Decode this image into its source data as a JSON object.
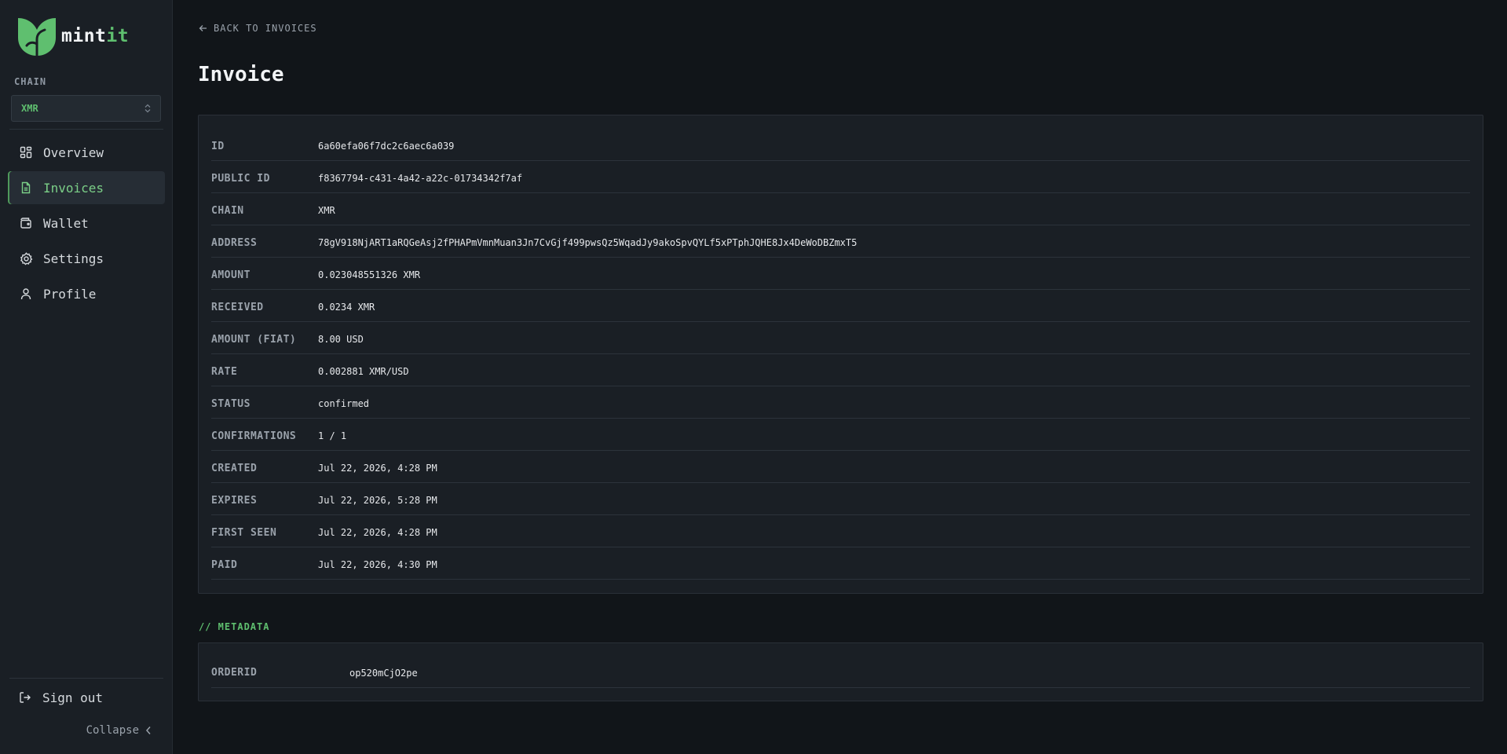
{
  "brand": {
    "name_main": "mint",
    "name_accent": "it",
    "accent_color": "#5fbf6f"
  },
  "sidebar": {
    "chain_label": "CHAIN",
    "chain_value": "XMR",
    "nav": [
      {
        "label": "Overview",
        "icon": "grid-icon",
        "active": false
      },
      {
        "label": "Invoices",
        "icon": "document-icon",
        "active": true
      },
      {
        "label": "Wallet",
        "icon": "wallet-icon",
        "active": false
      },
      {
        "label": "Settings",
        "icon": "gear-icon",
        "active": false
      },
      {
        "label": "Profile",
        "icon": "user-icon",
        "active": false
      }
    ],
    "sign_out": "Sign out",
    "collapse": "Collapse"
  },
  "main": {
    "back_link": "BACK TO INVOICES",
    "title": "Invoice",
    "details": [
      {
        "key": "ID",
        "value": "6a60efa06f7dc2c6aec6a039"
      },
      {
        "key": "PUBLIC ID",
        "value": "f8367794-c431-4a42-a22c-01734342f7af"
      },
      {
        "key": "CHAIN",
        "value": "XMR"
      },
      {
        "key": "ADDRESS",
        "value": "78gV918NjART1aRQGeAsj2fPHAPmVmnMuan3Jn7CvGjf499pwsQz5WqadJy9akoSpvQYLf5xPTphJQHE8Jx4DeWoDBZmxT5"
      },
      {
        "key": "AMOUNT",
        "value": "0.023048551326 XMR"
      },
      {
        "key": "RECEIVED",
        "value": "0.0234 XMR"
      },
      {
        "key": "AMOUNT (FIAT)",
        "value": "8.00 USD"
      },
      {
        "key": "RATE",
        "value": "0.002881 XMR/USD"
      },
      {
        "key": "STATUS",
        "value": "confirmed"
      },
      {
        "key": "CONFIRMATIONS",
        "value": "1 / 1"
      },
      {
        "key": "CREATED",
        "value": "Jul 22, 2026, 4:28 PM"
      },
      {
        "key": "EXPIRES",
        "value": "Jul 22, 2026, 5:28 PM"
      },
      {
        "key": "FIRST SEEN",
        "value": "Jul 22, 2026, 4:28 PM"
      },
      {
        "key": "PAID",
        "value": "Jul 22, 2026, 4:30 PM"
      }
    ],
    "metadata_heading": "// METADATA",
    "metadata": [
      {
        "key": "ORDERID",
        "value": "op520mCjO2pe"
      }
    ]
  }
}
